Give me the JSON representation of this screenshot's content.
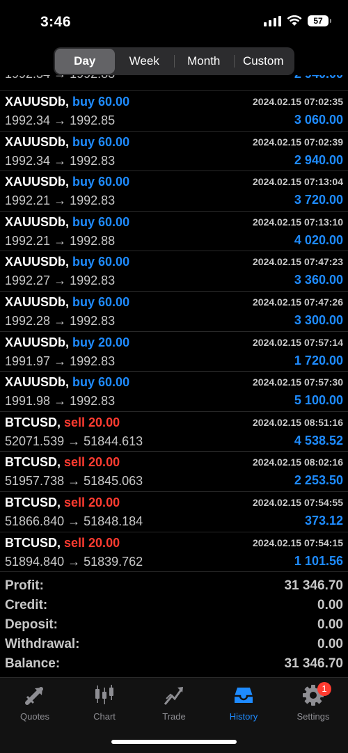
{
  "status_bar": {
    "time": "3:46",
    "battery": "57"
  },
  "period_tabs": [
    {
      "label": "Day",
      "active": true
    },
    {
      "label": "Week",
      "active": false
    },
    {
      "label": "Month",
      "active": false
    },
    {
      "label": "Custom",
      "active": false
    }
  ],
  "partial_row": {
    "left": "1992.34 → 1992.83",
    "right": "2 940.00"
  },
  "deals": [
    {
      "symbol": "XAUUSDb,",
      "side": "buy",
      "volume": "buy 60.00",
      "time": "2024.02.15 07:02:35",
      "prices": "1992.34 → 1992.85",
      "profit": "3 060.00"
    },
    {
      "symbol": "XAUUSDb,",
      "side": "buy",
      "volume": "buy 60.00",
      "time": "2024.02.15 07:02:39",
      "prices": "1992.34 → 1992.83",
      "profit": "2 940.00"
    },
    {
      "symbol": "XAUUSDb,",
      "side": "buy",
      "volume": "buy 60.00",
      "time": "2024.02.15 07:13:04",
      "prices": "1992.21 → 1992.83",
      "profit": "3 720.00"
    },
    {
      "symbol": "XAUUSDb,",
      "side": "buy",
      "volume": "buy 60.00",
      "time": "2024.02.15 07:13:10",
      "prices": "1992.21 → 1992.88",
      "profit": "4 020.00"
    },
    {
      "symbol": "XAUUSDb,",
      "side": "buy",
      "volume": "buy 60.00",
      "time": "2024.02.15 07:47:23",
      "prices": "1992.27 → 1992.83",
      "profit": "3 360.00"
    },
    {
      "symbol": "XAUUSDb,",
      "side": "buy",
      "volume": "buy 60.00",
      "time": "2024.02.15 07:47:26",
      "prices": "1992.28 → 1992.83",
      "profit": "3 300.00"
    },
    {
      "symbol": "XAUUSDb,",
      "side": "buy",
      "volume": "buy 20.00",
      "time": "2024.02.15 07:57:14",
      "prices": "1991.97 → 1992.83",
      "profit": "1 720.00"
    },
    {
      "symbol": "XAUUSDb,",
      "side": "buy",
      "volume": "buy 60.00",
      "time": "2024.02.15 07:57:30",
      "prices": "1991.98 → 1992.83",
      "profit": "5 100.00"
    },
    {
      "symbol": "BTCUSD,",
      "side": "sell",
      "volume": "sell 20.00",
      "time": "2024.02.15 08:51:16",
      "prices": "52071.539 → 51844.613",
      "profit": "4 538.52"
    },
    {
      "symbol": "BTCUSD,",
      "side": "sell",
      "volume": "sell 20.00",
      "time": "2024.02.15 08:02:16",
      "prices": "51957.738 → 51845.063",
      "profit": "2 253.50"
    },
    {
      "symbol": "BTCUSD,",
      "side": "sell",
      "volume": "sell 20.00",
      "time": "2024.02.15 07:54:55",
      "prices": "51866.840 → 51848.184",
      "profit": "373.12"
    },
    {
      "symbol": "BTCUSD,",
      "side": "sell",
      "volume": "sell 20.00",
      "time": "2024.02.15 07:54:15",
      "prices": "51894.840 → 51839.762",
      "profit": "1 101.56"
    }
  ],
  "summary": [
    {
      "label": "Profit:",
      "value": "31 346.70"
    },
    {
      "label": "Credit:",
      "value": "0.00"
    },
    {
      "label": "Deposit:",
      "value": "0.00"
    },
    {
      "label": "Withdrawal:",
      "value": "0.00"
    },
    {
      "label": "Balance:",
      "value": "31 346.70"
    }
  ],
  "tab_bar": [
    {
      "label": "Quotes",
      "icon": "quotes-icon",
      "active": false
    },
    {
      "label": "Chart",
      "icon": "chart-icon",
      "active": false
    },
    {
      "label": "Trade",
      "icon": "trade-icon",
      "active": false
    },
    {
      "label": "History",
      "icon": "history-icon",
      "active": true
    },
    {
      "label": "Settings",
      "icon": "settings-icon",
      "active": false,
      "badge": "1"
    }
  ],
  "colors": {
    "buy": "#1e8bff",
    "sell": "#ff3b30",
    "accent": "#1e8bff"
  }
}
